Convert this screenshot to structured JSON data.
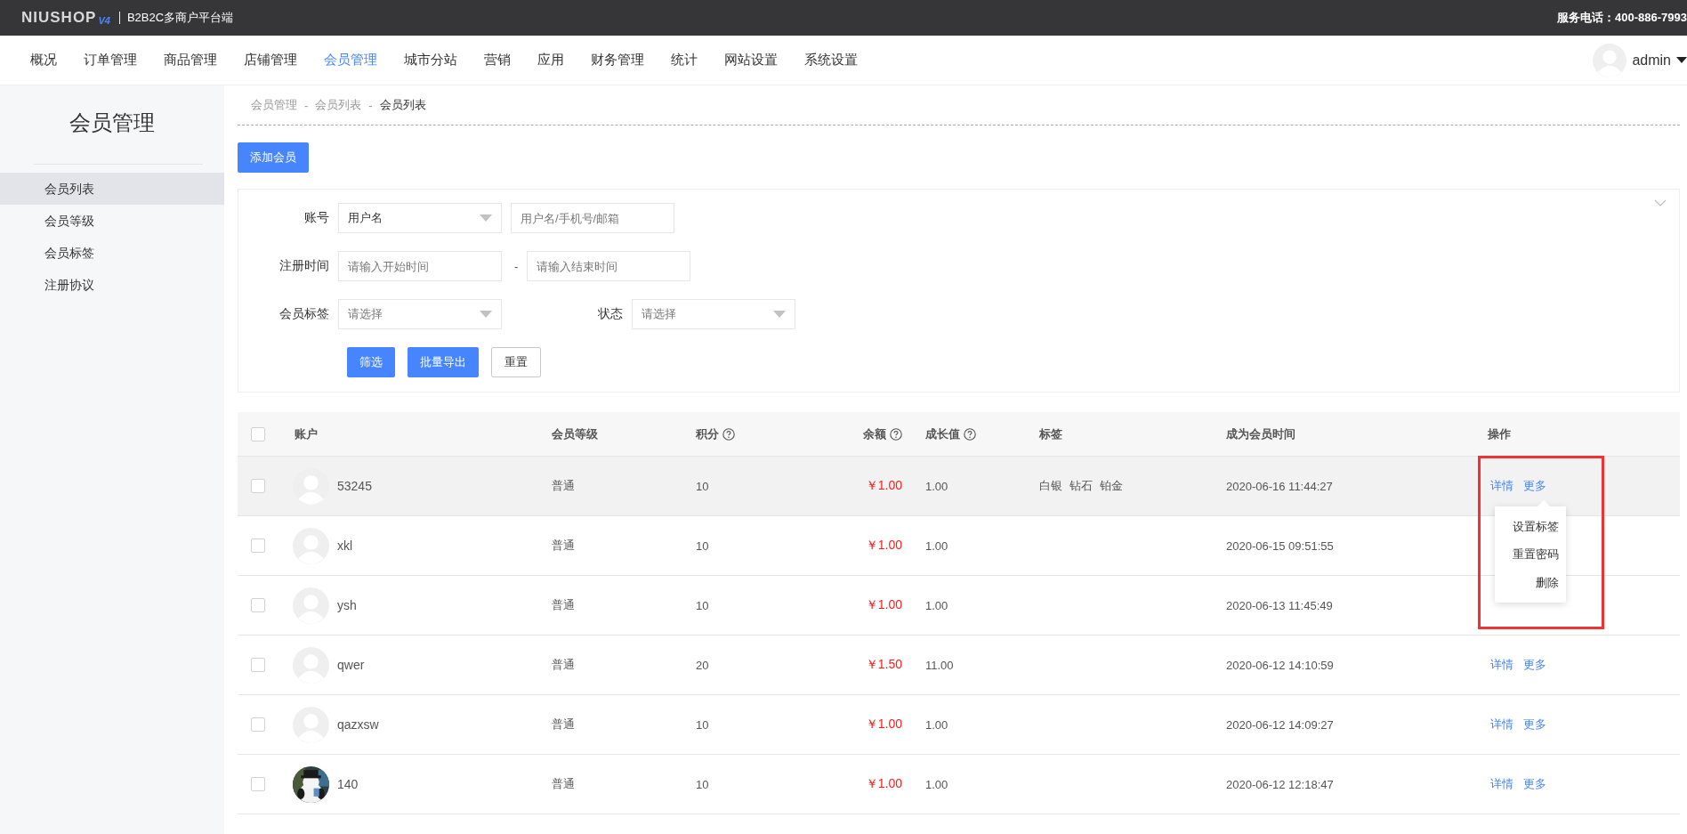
{
  "topbar": {
    "logo": "NIUSHOP",
    "logo_version": "V4",
    "platform": "B2B2C多商户平台端",
    "phone": "服务电话：400-886-7993"
  },
  "nav": {
    "items": [
      {
        "label": "概况",
        "selected": false
      },
      {
        "label": "订单管理",
        "selected": false
      },
      {
        "label": "商品管理",
        "selected": false
      },
      {
        "label": "店铺管理",
        "selected": false
      },
      {
        "label": "会员管理",
        "selected": true
      },
      {
        "label": "城市分站",
        "selected": false
      },
      {
        "label": "营销",
        "selected": false
      },
      {
        "label": "应用",
        "selected": false
      },
      {
        "label": "财务管理",
        "selected": false
      },
      {
        "label": "统计",
        "selected": false
      },
      {
        "label": "网站设置",
        "selected": false
      },
      {
        "label": "系统设置",
        "selected": false
      }
    ],
    "user": "admin"
  },
  "sidebar": {
    "title": "会员管理",
    "items": [
      {
        "label": "会员列表",
        "selected": true
      },
      {
        "label": "会员等级",
        "selected": false
      },
      {
        "label": "会员标签",
        "selected": false
      },
      {
        "label": "注册协议",
        "selected": false
      }
    ]
  },
  "breadcrumb": [
    {
      "kind": "link",
      "text": "会员管理"
    },
    {
      "kind": "sep",
      "text": "-"
    },
    {
      "kind": "link",
      "text": "会员列表"
    },
    {
      "kind": "sep",
      "text": "-"
    },
    {
      "kind": "current",
      "text": "会员列表"
    }
  ],
  "add_button": "添加会员",
  "filter": {
    "account_label": "账号",
    "account_type": {
      "value": "用户名"
    },
    "account_input": {
      "placeholder": "用户名/手机号/邮箱"
    },
    "date_label": "注册时间",
    "date_start": {
      "placeholder": "请输入开始时间"
    },
    "date_sep": "-",
    "date_end": {
      "placeholder": "请输入结束时间"
    },
    "tag_label": "会员标签",
    "tag_select": {
      "placeholder": "请选择"
    },
    "status_label": "状态",
    "status_select": {
      "placeholder": "请选择"
    },
    "buttons": [
      {
        "kind": "primary",
        "label": "筛选"
      },
      {
        "kind": "primary",
        "label": "批量导出"
      },
      {
        "kind": "plain",
        "label": "重置"
      }
    ]
  },
  "table": {
    "header_checked": false,
    "columns": [
      {
        "label": "账户",
        "help": false
      },
      {
        "label": "会员等级",
        "help": false
      },
      {
        "label": "积分",
        "help": true
      },
      {
        "label": "余额",
        "help": true
      },
      {
        "label": "成长值",
        "help": true
      },
      {
        "label": "标签",
        "help": false
      },
      {
        "label": "成为会员时间",
        "help": false
      },
      {
        "label": "操作",
        "help": false
      }
    ],
    "rows": [
      {
        "checked": false,
        "hovered": true,
        "avatar": {
          "kind": "default"
        },
        "account": "53245",
        "level": "普通",
        "points": "10",
        "balance": "￥1.00",
        "growth": "1.00",
        "tags": [
          "白银",
          "钻石",
          "铂金"
        ],
        "joined": "2020-06-16 11:44:27",
        "actions": [
          "详情",
          "更多"
        ],
        "more_menu": {
          "framed": true,
          "items": [
            "设置标签",
            "重置密码",
            "删除"
          ]
        }
      },
      {
        "checked": false,
        "hovered": false,
        "avatar": {
          "kind": "default"
        },
        "account": "xkl",
        "level": "普通",
        "points": "10",
        "balance": "￥1.00",
        "growth": "1.00",
        "joined": "2020-06-15 09:51:55"
      },
      {
        "checked": false,
        "hovered": false,
        "avatar": {
          "kind": "default"
        },
        "account": "ysh",
        "level": "普通",
        "points": "10",
        "balance": "￥1.00",
        "growth": "1.00",
        "joined": "2020-06-13 11:45:49"
      },
      {
        "checked": false,
        "hovered": false,
        "avatar": {
          "kind": "default"
        },
        "account": "qwer",
        "level": "普通",
        "points": "20",
        "balance": "￥1.50",
        "growth": "11.00",
        "joined": "2020-06-12 14:10:59",
        "actions": [
          "详情",
          "更多"
        ]
      },
      {
        "checked": false,
        "hovered": false,
        "avatar": {
          "kind": "default"
        },
        "account": "qazxsw",
        "level": "普通",
        "points": "10",
        "balance": "￥1.00",
        "growth": "1.00",
        "joined": "2020-06-12 14:09:27",
        "actions": [
          "详情",
          "更多"
        ]
      },
      {
        "checked": false,
        "hovered": false,
        "avatar": {
          "kind": "picture"
        },
        "account": "140",
        "level": "普通",
        "points": "10",
        "balance": "￥1.00",
        "growth": "1.00",
        "joined": "2020-06-12 12:18:47",
        "actions": [
          "详情",
          "更多"
        ]
      }
    ]
  }
}
